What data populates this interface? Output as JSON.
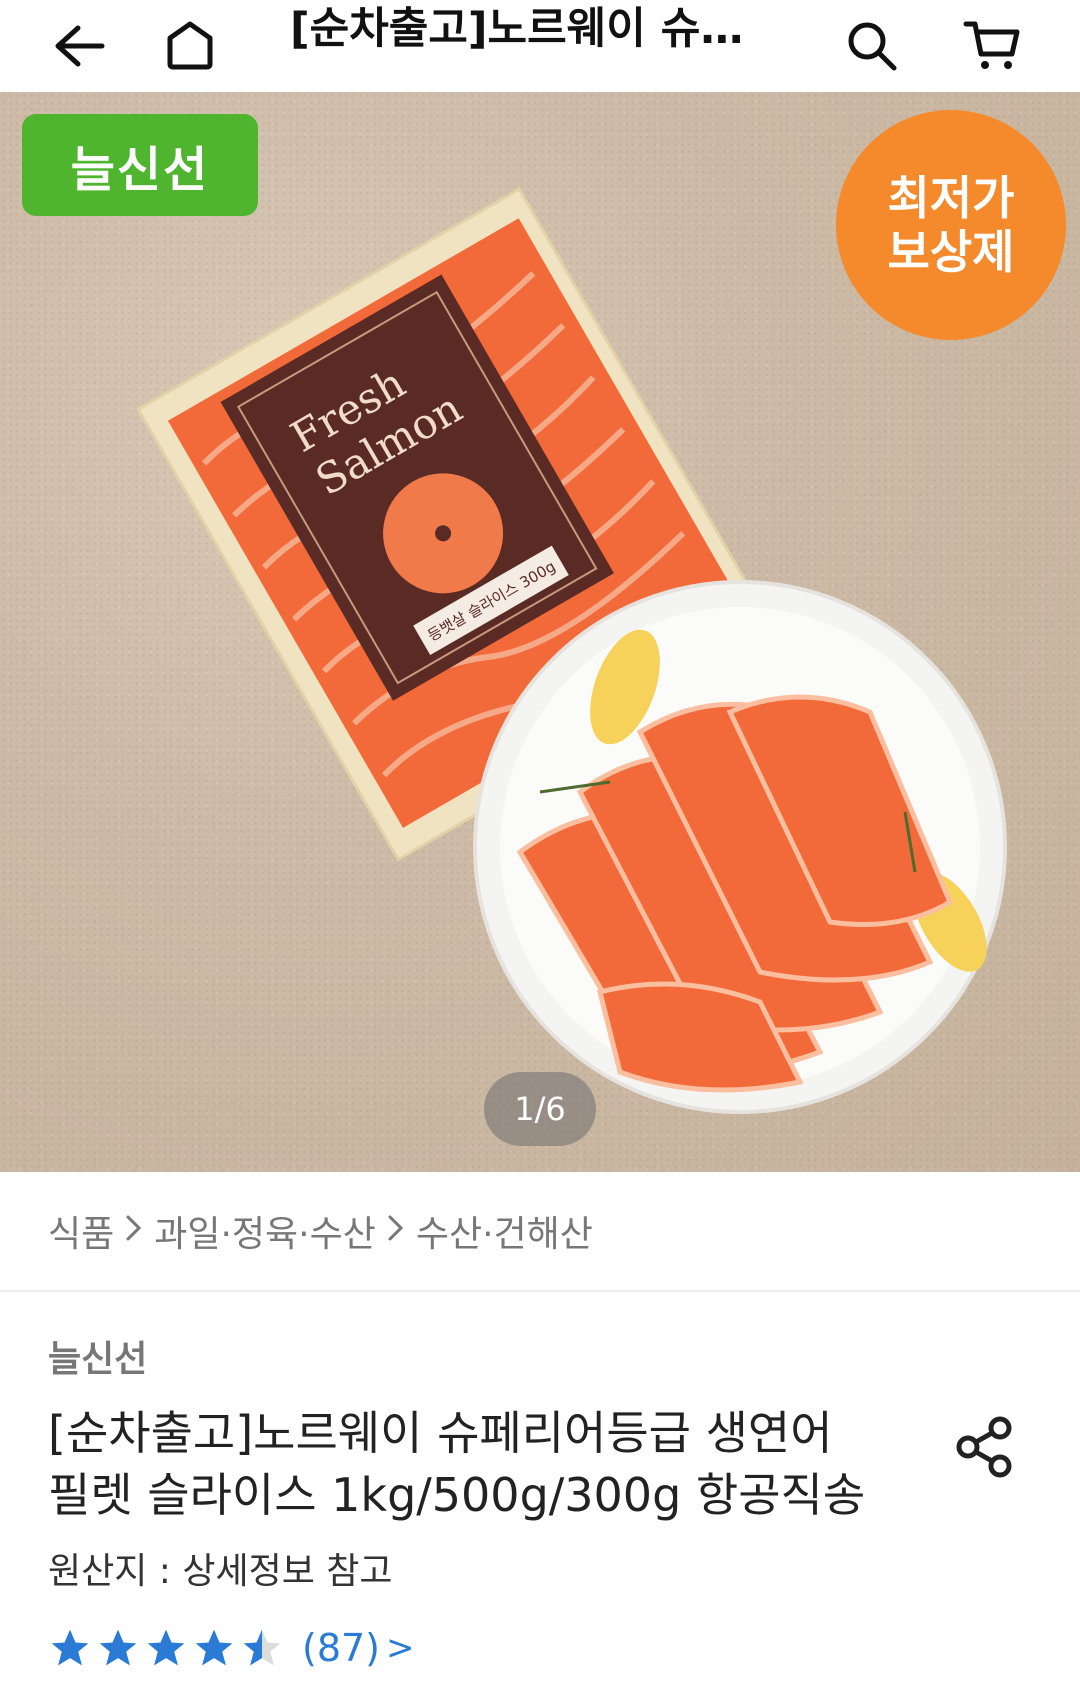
{
  "header": {
    "title": "[순차출고]노르웨이 슈…",
    "icons": [
      "back-arrow-icon",
      "home-icon",
      "search-icon",
      "cart-icon"
    ]
  },
  "hero": {
    "badge_left": "늘신선",
    "badge_right_line1": "최저가",
    "badge_right_line2": "보상제",
    "counter": "1/6",
    "package_text_1": "Fresh",
    "package_text_2": "Salmon",
    "package_label": "등뱃살 슬라이스 300g",
    "colors": {
      "badge_left": "#4fb52f",
      "badge_right": "#f58a2c"
    }
  },
  "breadcrumb": {
    "items": [
      "식품",
      "과일·정육·수산",
      "수산·건해산"
    ]
  },
  "product": {
    "brand": "늘신선",
    "title_line1": "[순차출고]노르웨이 슈페리어등급 생연어",
    "title_line2": "필렛 슬라이스 1kg/500g/300g 항공직송",
    "origin": "원산지 : 상세정보 참고",
    "rating": 4.5,
    "review_count": "(87)",
    "review_chevron": ">",
    "star_color": "#2a7bd6"
  }
}
